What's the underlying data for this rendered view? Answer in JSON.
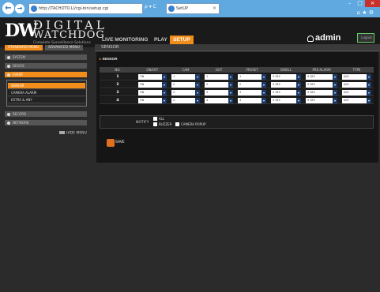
{
  "browser": {
    "address": "http://TACHOTO.LI/cgi-bin/setup.cgi",
    "address_tools": "ρ ▾ C",
    "tab_title": "SetUP",
    "tab_close": "×",
    "minimize": "–",
    "maximize": "□",
    "close": "×",
    "right_icons": "⌂ ★ ⚙",
    "back_icon": "arrow-left-icon",
    "forward_icon": "arrow-right-icon"
  },
  "app": {
    "logo_dw": "DW",
    "logo_line1": "DIGITAL",
    "logo_line2": "WATCHDOG",
    "logo_sub": "Complete Surveillance Solutions",
    "menu": [
      "LIVE MONITORING",
      "PLAY",
      "SETUP"
    ],
    "active_menu": "SETUP",
    "user": "admin",
    "logout": "Logout",
    "accent": "#f28c1a"
  },
  "sidebar": {
    "top_tabs": [
      "STANDARD MENU",
      "ADVANCED MENU"
    ],
    "items": [
      {
        "label": "SYSTEM"
      },
      {
        "label": "DEVICE"
      },
      {
        "label": "EVENT"
      },
      {
        "label": "RECORD"
      },
      {
        "label": "NETWORK"
      }
    ],
    "sub_items": [
      "SENSOR",
      "CAMERA ALARM",
      "EXTRA & ANY"
    ],
    "hide_menu": "HIDE MENU"
  },
  "content": {
    "breadcrumb": "SENSOR",
    "section": "SENSOR",
    "columns": [
      "NO.",
      "ON/OFF",
      "CAM",
      "OUT",
      "PRESET",
      "DWELL",
      "PRE-ALARM",
      "TYPE"
    ],
    "rows": [
      {
        "no": "1",
        "onoff": "ON",
        "cam": "1",
        "out": "1",
        "preset": "1",
        "dwell": "5 SEC",
        "prealarm": "5 SEC",
        "type": "N/O"
      },
      {
        "no": "2",
        "onoff": "ON",
        "cam": "2",
        "out": "2",
        "preset": "2",
        "dwell": "5 SEC",
        "prealarm": "5 SEC",
        "type": "N/O"
      },
      {
        "no": "3",
        "onoff": "ON",
        "cam": "3",
        "out": "3",
        "preset": "3",
        "dwell": "5 SEC",
        "prealarm": "5 SEC",
        "type": "N/O"
      },
      {
        "no": "4",
        "onoff": "ON",
        "cam": "4",
        "out": "4",
        "preset": "4",
        "dwell": "5 SEC",
        "prealarm": "5 SEC",
        "type": "N/O"
      }
    ],
    "notify_label": "NOTIFY",
    "notify_all": "ALL",
    "notify_buzzer": "BUZZER",
    "notify_camera_popup": "CAMERA POPUP",
    "save": "SAVE"
  }
}
